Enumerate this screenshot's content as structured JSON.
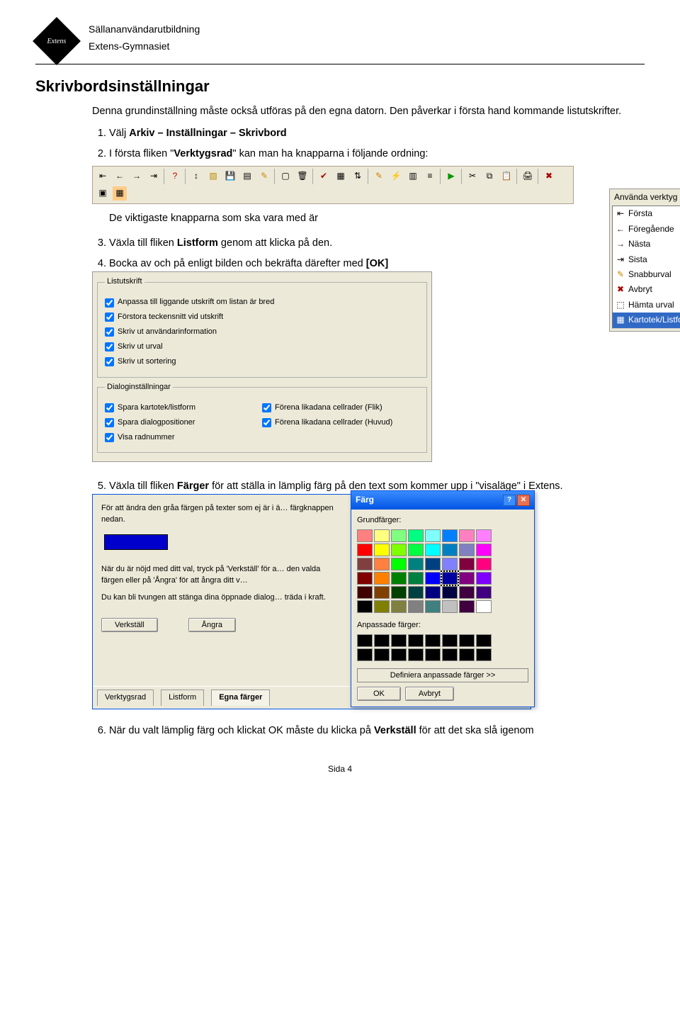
{
  "header": {
    "logo_text": "Extens",
    "line1": "Sällananvändarutbildning",
    "line2": "Extens-Gymnasiet"
  },
  "title": "Skrivbordsinställningar",
  "intro": "Denna grundinställning måste också utföras på den egna datorn. Den påverkar i första hand kommande listutskrifter.",
  "steps": {
    "s1_pre": "Välj ",
    "s1_bold": "Arkiv – Inställningar – Skrivbord",
    "s2_a": "I första fliken \"",
    "s2_b": "Verktygsrad",
    "s2_c": "\" kan man ha knapparna i följande ordning:",
    "indent_text": "De viktigaste knapparna som ska vara med är",
    "s3_a": "Växla till fliken ",
    "s3_b": "Listform",
    "s3_c": " genom att klicka på den.",
    "s4_a": "Bocka av och på enligt bilden och bekräfta därefter med ",
    "s4_b": "[OK]",
    "s5_a": "Växla till fliken ",
    "s5_b": "Färger",
    "s5_c": " för att ställa in lämplig färg på den text som kommer upp i \"visaläge\" i Extens.",
    "s6_a": "När du valt lämplig färg och klickat OK måste du klicka på ",
    "s6_b": "Verkställ",
    "s6_c": " för att det ska slå igenom"
  },
  "anvanda_panel": {
    "title": "Använda verktyg",
    "items": [
      {
        "icon": "⇤",
        "label": "Första"
      },
      {
        "icon": "←",
        "label": "Föregående"
      },
      {
        "icon": "→",
        "label": "Nästa"
      },
      {
        "icon": "⇥",
        "label": "Sista"
      },
      {
        "icon": "✎",
        "label": "Snabburval"
      },
      {
        "icon": "✖",
        "label": "Avbryt"
      },
      {
        "icon": "⬚",
        "label": "Hämta urval"
      },
      {
        "icon": "▦",
        "label": "Kartotek/Listform"
      }
    ]
  },
  "listutskrift": {
    "legend1": "Listutskrift",
    "c1": "Anpassa till liggande utskrift om listan är bred",
    "c2": "Förstora teckensnitt vid utskrift",
    "c3": "Skriv ut användarinformation",
    "c4": "Skriv ut urval",
    "c5": "Skriv ut sortering",
    "legend2": "Dialoginställningar",
    "d1": "Spara kartotek/listform",
    "d2": "Spara dialogpositioner",
    "d3": "Visa radnummer",
    "d4": "Förena likadana cellrader (Flik)",
    "d5": "Förena likadana cellrader (Huvud)"
  },
  "color_main": {
    "p1": "För att ändra den gråa färgen på texter som ej är i ä… färgknappen nedan.",
    "p2": "När du är nöjd med ditt val, tryck på 'Verkställ' för a… den valda färgen eller på 'Ångra' för att ångra ditt v…",
    "p3": "Du kan bli tvungen att stänga dina öppnade dialog… träda i kraft.",
    "btn_verk": "Verkställ",
    "btn_angra": "Ångra",
    "tab1": "Verktygsrad",
    "tab2": "Listform",
    "tab3": "Egna färger"
  },
  "farg_dialog": {
    "title": "Färg",
    "grundfarger": "Grundfärger:",
    "anpassade": "Anpassade färger:",
    "definiera": "Definiera anpassade färger >>",
    "ok": "OK",
    "avbryt": "Avbryt",
    "colors": [
      "#ff8080",
      "#ffff80",
      "#80ff80",
      "#00ff80",
      "#80ffff",
      "#0080ff",
      "#ff80c0",
      "#ff80ff",
      "#ff0000",
      "#ffff00",
      "#80ff00",
      "#00ff40",
      "#00ffff",
      "#0080c0",
      "#8080c0",
      "#ff00ff",
      "#804040",
      "#ff8040",
      "#00ff00",
      "#008080",
      "#004080",
      "#8080ff",
      "#800040",
      "#ff0080",
      "#800000",
      "#ff8000",
      "#008000",
      "#008040",
      "#0000ff",
      "#0000a0",
      "#800080",
      "#8000ff",
      "#400000",
      "#804000",
      "#004000",
      "#004040",
      "#000080",
      "#000040",
      "#400040",
      "#400080",
      "#000000",
      "#808000",
      "#808040",
      "#808080",
      "#408080",
      "#c0c0c0",
      "#400040",
      "#ffffff"
    ]
  },
  "footer": "Sida 4"
}
